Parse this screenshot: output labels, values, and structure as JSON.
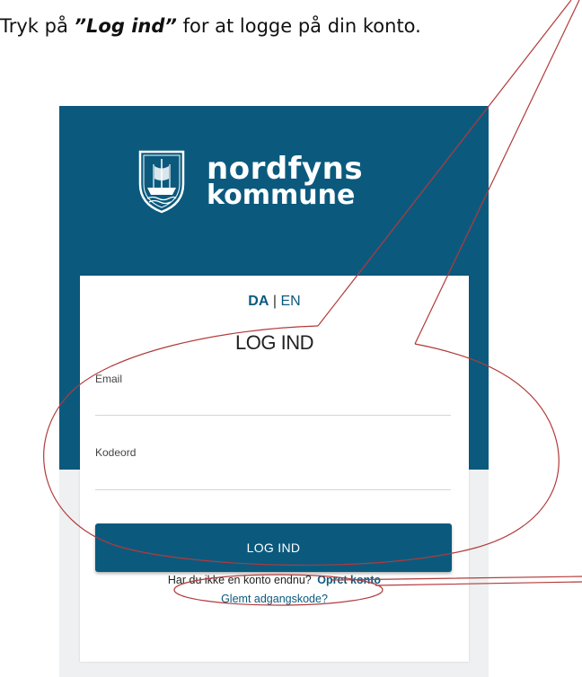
{
  "instruction": {
    "prefix": "Tryk på ",
    "emphasis": "”Log ind”",
    "suffix": " for at logge på din konto."
  },
  "logo": {
    "line1": "nordfyns",
    "line2": "kommune"
  },
  "lang": {
    "da": "DA",
    "separator": "|",
    "en": "EN"
  },
  "form": {
    "title": "LOG IND",
    "email_label": "Email",
    "email_value": "",
    "password_label": "Kodeord",
    "password_value": "",
    "submit_label": "LOG IND",
    "signup_prompt": "Har du ikke en konto endnu?",
    "signup_link": "Opret konto",
    "forgot_link": "Glemt adgangskode?"
  },
  "colors": {
    "brand": "#0b5a7e",
    "annotation": "#b23a3a",
    "background_light": "#eef0f1"
  },
  "icons": {
    "crest": "coat-of-arms-ship-icon"
  }
}
